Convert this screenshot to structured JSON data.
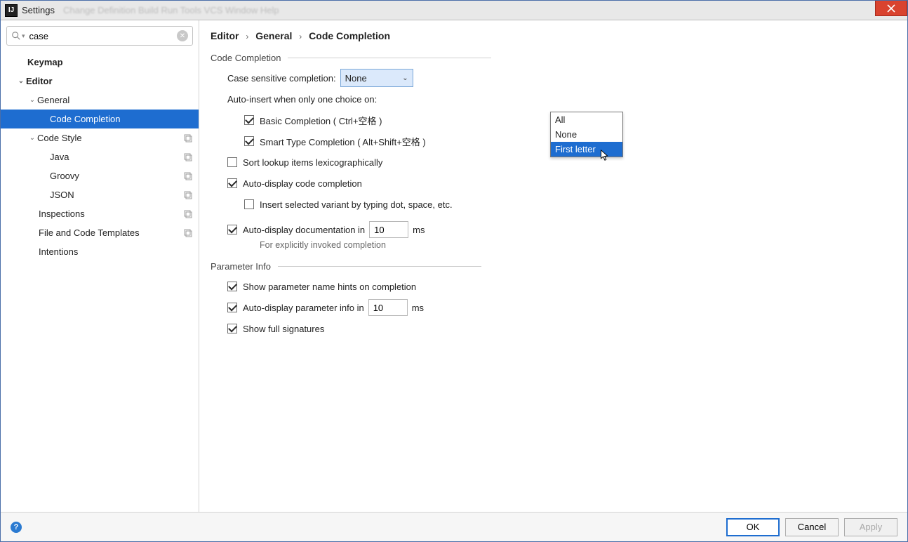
{
  "window": {
    "title": "Settings",
    "shadow_menu": "Change  Definition  Build  Run  Tools  VCS  Window  Help"
  },
  "search": {
    "value": "case"
  },
  "tree": {
    "keymap": "Keymap",
    "editor": "Editor",
    "general": "General",
    "code_completion": "Code Completion",
    "code_style": "Code Style",
    "java": "Java",
    "groovy": "Groovy",
    "json": "JSON",
    "inspections": "Inspections",
    "file_templates": "File and Code Templates",
    "intentions": "Intentions"
  },
  "crumbs": {
    "a": "Editor",
    "b": "General",
    "c": "Code Completion"
  },
  "section": {
    "code_completion": "Code Completion",
    "parameter_info": "Parameter Info"
  },
  "cc": {
    "case_label": "Case sensitive completion:",
    "case_value": "None",
    "case_options": {
      "o0": "All",
      "o1": "None",
      "o2": "First letter"
    },
    "auto_insert_label": "Auto-insert when only one choice on:",
    "basic": "Basic Completion ( Ctrl+空格 )",
    "smart": "Smart Type Completion ( Alt+Shift+空格 )",
    "sort_lex": "Sort lookup items lexicographically",
    "auto_display": "Auto-display code completion",
    "insert_variant": "Insert selected variant by typing dot, space, etc.",
    "doc_label_pre": "Auto-display documentation in",
    "doc_value": "10",
    "doc_label_post": "ms",
    "doc_hint": "For explicitly invoked completion"
  },
  "pi": {
    "show_hints": "Show parameter name hints on completion",
    "auto_label_pre": "Auto-display parameter info in",
    "auto_value": "10",
    "auto_label_post": "ms",
    "full_sig": "Show full signatures"
  },
  "footer": {
    "ok": "OK",
    "cancel": "Cancel",
    "apply": "Apply"
  }
}
